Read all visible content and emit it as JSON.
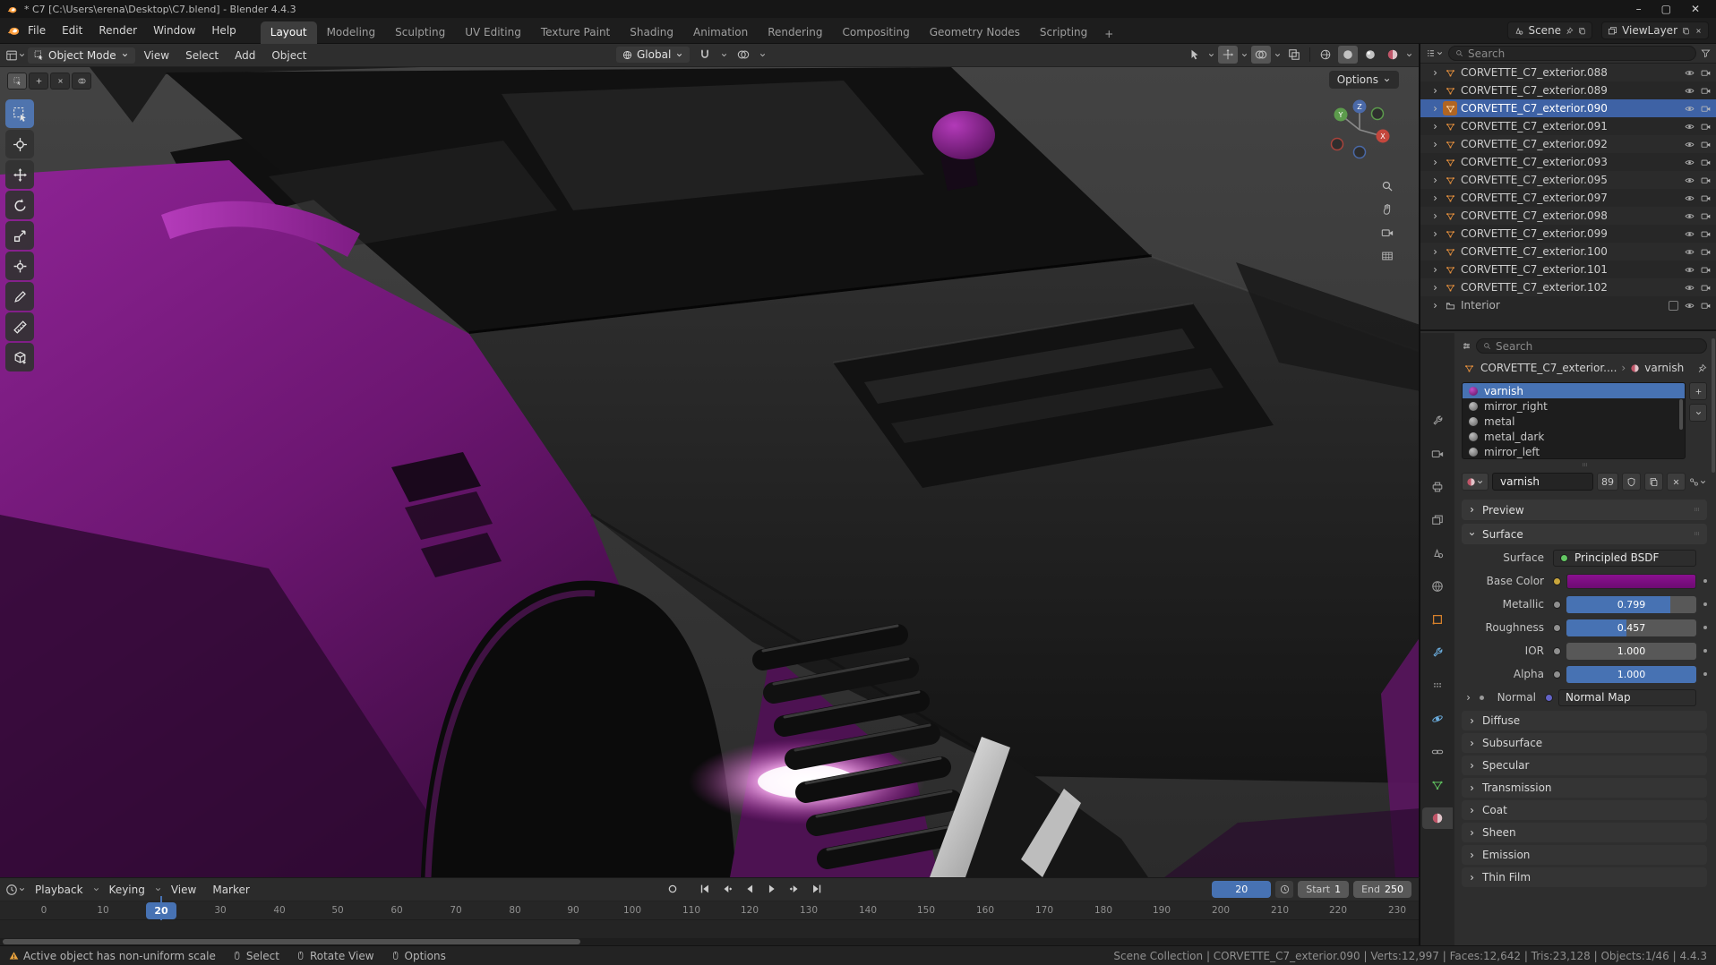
{
  "window": {
    "title": "* C7 [C:\\Users\\erena\\Desktop\\C7.blend] - Blender 4.4.3"
  },
  "menubar": {
    "menus": [
      {
        "label": "File"
      },
      {
        "label": "Edit"
      },
      {
        "label": "Render"
      },
      {
        "label": "Window"
      },
      {
        "label": "Help"
      }
    ],
    "workspaces": [
      {
        "label": "Layout"
      },
      {
        "label": "Modeling"
      },
      {
        "label": "Sculpting"
      },
      {
        "label": "UV Editing"
      },
      {
        "label": "Texture Paint"
      },
      {
        "label": "Shading"
      },
      {
        "label": "Animation"
      },
      {
        "label": "Rendering"
      },
      {
        "label": "Compositing"
      },
      {
        "label": "Geometry Nodes"
      },
      {
        "label": "Scripting"
      }
    ],
    "active_workspace": "Layout",
    "add_workspace": "+",
    "scene": {
      "label": "Scene"
    },
    "viewlayer": {
      "label": "ViewLayer"
    }
  },
  "viewport": {
    "mode": "Object Mode",
    "menus": [
      {
        "label": "View"
      },
      {
        "label": "Select"
      },
      {
        "label": "Add"
      },
      {
        "label": "Object"
      }
    ],
    "orientation": "Global",
    "options": "Options"
  },
  "outliner": {
    "search_placeholder": "Search",
    "items": [
      {
        "label": "CORVETTE_C7_exterior.088"
      },
      {
        "label": "CORVETTE_C7_exterior.089"
      },
      {
        "label": "CORVETTE_C7_exterior.090"
      },
      {
        "label": "CORVETTE_C7_exterior.091"
      },
      {
        "label": "CORVETTE_C7_exterior.092"
      },
      {
        "label": "CORVETTE_C7_exterior.093"
      },
      {
        "label": "CORVETTE_C7_exterior.095"
      },
      {
        "label": "CORVETTE_C7_exterior.097"
      },
      {
        "label": "CORVETTE_C7_exterior.098"
      },
      {
        "label": "CORVETTE_C7_exterior.099"
      },
      {
        "label": "CORVETTE_C7_exterior.100"
      },
      {
        "label": "CORVETTE_C7_exterior.101"
      },
      {
        "label": "CORVETTE_C7_exterior.102"
      }
    ],
    "active_item": "CORVETTE_C7_exterior.090",
    "collection": {
      "label": "Interior"
    }
  },
  "properties": {
    "search_placeholder": "Search",
    "breadcrumb": {
      "object": "CORVETTE_C7_exterior....",
      "separator": "›",
      "material": "varnish"
    },
    "slots": [
      {
        "name": "varnish"
      },
      {
        "name": "mirror_right"
      },
      {
        "name": "metal"
      },
      {
        "name": "metal_dark"
      },
      {
        "name": "mirror_left"
      }
    ],
    "active_slot": "varnish",
    "name_field": {
      "value": "varnish",
      "users": "89"
    },
    "preview_panel": "Preview",
    "surface_panel": {
      "title": "Surface",
      "surface_label": "Surface",
      "surface_value": "Principled BSDF",
      "base_color_label": "Base Color",
      "base_color_hex": "#7b0c80",
      "sliders": [
        {
          "label": "Metallic",
          "value": "0.799"
        },
        {
          "label": "Roughness",
          "value": "0.457"
        },
        {
          "label": "IOR",
          "value": "1.000"
        },
        {
          "label": "Alpha",
          "value": "1.000"
        }
      ],
      "normal_label": "Normal",
      "normal_value": "Normal Map"
    },
    "collapsed_panels": [
      {
        "label": "Diffuse"
      },
      {
        "label": "Subsurface"
      },
      {
        "label": "Specular"
      },
      {
        "label": "Transmission"
      },
      {
        "label": "Coat"
      },
      {
        "label": "Sheen"
      },
      {
        "label": "Emission"
      },
      {
        "label": "Thin Film"
      }
    ]
  },
  "timeline": {
    "menus": [
      {
        "label": "Playback"
      },
      {
        "label": "Keying"
      },
      {
        "label": "View"
      },
      {
        "label": "Marker"
      }
    ],
    "current_frame": "20",
    "start_label": "Start",
    "start_value": "1",
    "end_label": "End",
    "end_value": "250",
    "ticks": [
      "0",
      "10",
      "20",
      "30",
      "40",
      "50",
      "60",
      "70",
      "80",
      "90",
      "100",
      "110",
      "120",
      "130",
      "140",
      "150",
      "160",
      "170",
      "180",
      "190",
      "200",
      "210",
      "220",
      "230"
    ]
  },
  "statusbar": {
    "warning": "Active object has non-uniform scale",
    "hints": [
      {
        "label": "Select"
      },
      {
        "label": "Rotate View"
      },
      {
        "label": "Options"
      }
    ],
    "info": "Scene Collection | CORVETTE_C7_exterior.090 | Verts:12,997 | Faces:12,642 | Tris:23,128 | Objects:1/46 | 4.4.3"
  },
  "colors": {
    "accent": "#4772b3",
    "selection": "#3e62a5",
    "mesh_icon": "#e8913d",
    "base_color": "#7b0c80"
  }
}
